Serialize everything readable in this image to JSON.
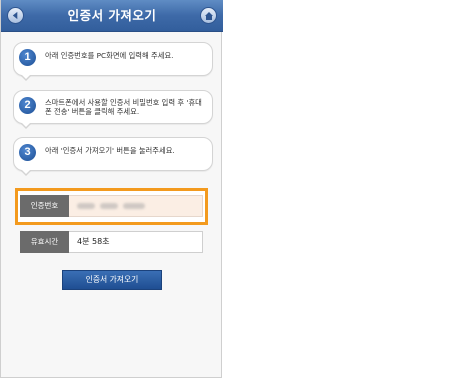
{
  "header": {
    "title": "인증서  가져오기"
  },
  "steps": [
    {
      "number": "1",
      "text": "아래 인증번호를 PC화면에 입력해 주세요."
    },
    {
      "number": "2",
      "text": "스마트폰에서 사용할 인증서 비밀번호 입력 후 '휴대폰 전송' 버튼을 클릭해 주세요."
    },
    {
      "number": "3",
      "text": "아래 '인증서 가져오기' 버튼을 눌러주세요."
    }
  ],
  "fields": {
    "code": {
      "label": "인증번호",
      "value_redacted": true
    },
    "time": {
      "label": "유효시간",
      "value": "4분 58초"
    }
  },
  "action": {
    "label": "인증서 가져오기"
  },
  "colors": {
    "header": "#3e6aa8",
    "highlight_border": "#f39a1e",
    "field_label_bg": "#6b6b6b",
    "button": "#1f4e92"
  }
}
